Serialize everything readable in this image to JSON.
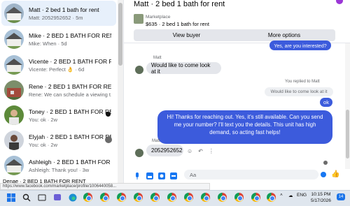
{
  "conversations": [
    {
      "title": "Matt · 2 bed 1 bath for rent",
      "preview": "Matt: 2052952652 · 5m",
      "active": true
    },
    {
      "title": "Mike · 2 BED 1 BATH FOR RENT",
      "preview": "Mike: When · 5d"
    },
    {
      "title": "Vicente · 2 BED 1 BATH FOR RENT",
      "preview": "Vicente: Perfect 👌 · 6d"
    },
    {
      "title": "Rene · 2 BED 1 BATH FOR RENT",
      "preview": "Rene: We can schedule a viewing t... · 2w"
    },
    {
      "title": "Toney · 2 BED 1 BATH FOR RE...",
      "preview": "You: ok · 2w"
    },
    {
      "title": "Elyjah · 2 BED 1 BATH FOR RE...",
      "preview": "You: ok · 2w"
    },
    {
      "title": "Ashleigh · 2 BED 1 BATH FOR RENT",
      "preview": "Ashleigh: Thank you! · 3w"
    },
    {
      "title": "Denae · 2 BED 1 BATH FOR RENT",
      "preview": ""
    }
  ],
  "chat": {
    "title": "Matt · 2 bed 1 bath for rent",
    "marketplace_label": "Marketplace",
    "listing": "$635 · 2 bed 1 bath for rent",
    "view_buyer": "View buyer",
    "more_options": "More options",
    "prev_bubble": "Yes, are you interested?",
    "sender1": "Matt",
    "msg1": "Would like to come look at it",
    "replied": "You replied to Matt",
    "quote": "Would like to come look at it",
    "reply": "ok",
    "outgoing": "Hi!  Thanks for reaching out.  Yes, it's still available.  Can you send me your number? I'll  text you the details.  This unit has high demand, so acting fast helps!",
    "sender2": "Matt",
    "msg2": "2052952652",
    "input_placeholder": "Aa"
  },
  "status_url": "https://www.facebook.com/marketplace/profile/1006440058...",
  "taskbar": {
    "lang": "ENG",
    "time": "10:15 PM",
    "date": "5/17/2026",
    "notifications": "14"
  }
}
